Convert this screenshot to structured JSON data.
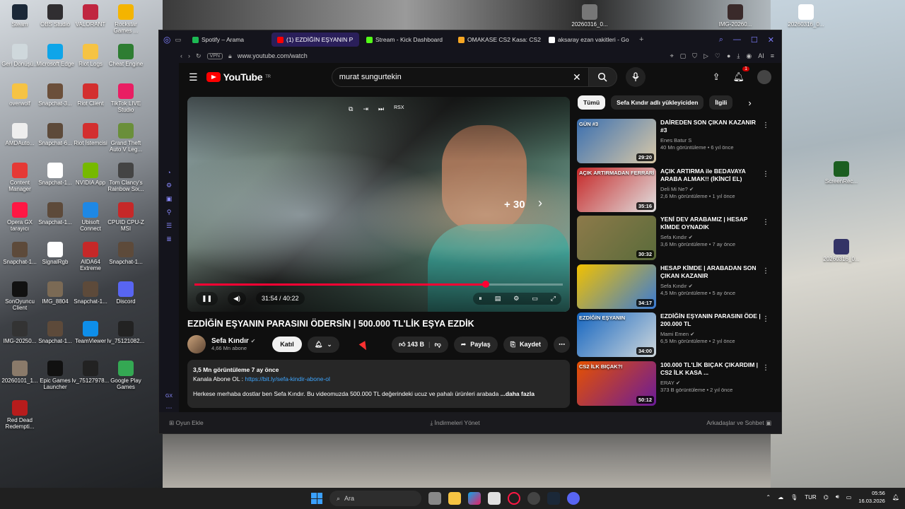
{
  "desktop": {
    "icons": [
      {
        "label": "Steam",
        "color": "#1b2838"
      },
      {
        "label": "OBS Studio",
        "color": "#302e31"
      },
      {
        "label": "VALORANT",
        "color": "#c02640"
      },
      {
        "label": "Rockstar Games ...",
        "color": "#f4b400"
      },
      {
        "label": "Geri Dönüşü...",
        "color": "#cfd8dc"
      },
      {
        "label": "Microsoft Edge",
        "color": "#0ea5e9"
      },
      {
        "label": "Riot Logs",
        "color": "#f6c343"
      },
      {
        "label": "Cheat Engine",
        "color": "#2e7d32"
      },
      {
        "label": "overwolf",
        "color": "#f6c343"
      },
      {
        "label": "Snapchat-3...",
        "color": "#6b4f3a"
      },
      {
        "label": "Riot Client",
        "color": "#d32f2f"
      },
      {
        "label": "TikTok LIVE Studio",
        "color": "#e91e63"
      },
      {
        "label": "AMDAuto...",
        "color": "#eeeeee"
      },
      {
        "label": "Snapchat-6...",
        "color": "#5d4a3a"
      },
      {
        "label": "Riot İstemcisi",
        "color": "#d32f2f"
      },
      {
        "label": "Grand Theft Auto V Leg...",
        "color": "#6a8f3a"
      },
      {
        "label": "Content Manager",
        "color": "#e53935"
      },
      {
        "label": "Snapchat-1...",
        "color": "#ffffff"
      },
      {
        "label": "NVIDIA App",
        "color": "#76b900"
      },
      {
        "label": "Tom Clancy's Rainbow Six...",
        "color": "#444444"
      },
      {
        "label": "Opera GX tarayıcı",
        "color": "#ff1744"
      },
      {
        "label": "Snapchat-1...",
        "color": "#5d4a3a"
      },
      {
        "label": "Ubisoft Connect",
        "color": "#1e88e5"
      },
      {
        "label": "CPUID CPU-Z MSI",
        "color": "#c62828"
      },
      {
        "label": "Snapchat-1...",
        "color": "#5d4a3a"
      },
      {
        "label": "SignalRgb",
        "color": "#ffffff"
      },
      {
        "label": "AIDA64 Extreme",
        "color": "#c62828"
      },
      {
        "label": "Snapchat-1...",
        "color": "#5d4a3a"
      },
      {
        "label": "SonOyuncu Client",
        "color": "#111111"
      },
      {
        "label": "IMG_8804",
        "color": "#7b6a55"
      },
      {
        "label": "Snapchat-1...",
        "color": "#5d4a3a"
      },
      {
        "label": "Discord",
        "color": "#5865f2"
      },
      {
        "label": "IMG-20250...",
        "color": "#333333"
      },
      {
        "label": "Snapchat-1...",
        "color": "#5d4a3a"
      },
      {
        "label": "TeamViewer",
        "color": "#0e8ee9"
      },
      {
        "label": "lv_75121082...",
        "color": "#222222"
      },
      {
        "label": "20260101_1...",
        "color": "#8a7a6a"
      },
      {
        "label": "Epic Games Launcher",
        "color": "#111111"
      },
      {
        "label": "lv_75127978...",
        "color": "#222222"
      },
      {
        "label": "Google Play Games",
        "color": "#34a853"
      },
      {
        "label": "Red Dead Redempti...",
        "color": "#b71c1c"
      }
    ],
    "top_icons": [
      {
        "label": "20260316_0...",
        "color": "#777777"
      },
      {
        "label": "IMG-20260...",
        "color": "#3a2a2a"
      },
      {
        "label": "20260316_0...",
        "color": "#ffffff"
      }
    ],
    "right_icons": [
      {
        "label": "ScreenRec...",
        "color": "#1b5e20"
      },
      {
        "label": "20260316_0...",
        "color": "#333366"
      }
    ]
  },
  "browser": {
    "tabs": [
      {
        "label": "Spotify – Arama",
        "color": "#1db954",
        "active": false
      },
      {
        "label": "(1) EZDİĞİN EŞYANIN P",
        "color": "#ff0000",
        "active": true
      },
      {
        "label": "Stream - Kick Dashboard",
        "color": "#53fc18",
        "active": false
      },
      {
        "label": "OMAKASE CS2 Kasa: CS2",
        "color": "#f6a623",
        "active": false
      },
      {
        "label": "aksaray ezan vakitleri - Go",
        "color": "#ffffff",
        "active": false
      }
    ],
    "new_tab": "+",
    "vpn": "VPN",
    "url": "www.youtube.com/watch",
    "ai": "AI",
    "status_left": "Oyun Ekle",
    "status_mid": "İndirmeleri Yönet",
    "status_right": "Arkadaşlar ve Sohbet",
    "sidebar_label": "GX"
  },
  "youtube": {
    "logo": "YouTube",
    "logo_region": "TR",
    "search_value": "murat sungurtekin",
    "notif_count": "1",
    "player": {
      "time": "31:54 / 40:22",
      "skip": "+ 30",
      "rsx": "RSX",
      "progress_fraction": 0.79
    },
    "video_title": "EZDİĞİN EŞYANIN PARASINI ÖDERSİN | 500.000 TL'LİK EŞYA EZDİK",
    "channel": {
      "name": "Sefa Kındır",
      "subs": "4,66 Mn abone",
      "join": "Katıl"
    },
    "likes": "143 B",
    "share": "Paylaş",
    "save": "Kaydet",
    "description": {
      "stats": "3,5 Mn görüntüleme  7 ay önce",
      "line1_prefix": "Kanala Abone OL : ",
      "line1_link": "https://bit.ly/sefa-kindir-abone-ol",
      "line2": "Herkese merhaba dostlar ben Sefa Kındır.  Bu videomuzda 500.000 TL değerindeki ucuz ve pahalı ürünleri arabada ",
      "more": "...daha fazla"
    },
    "chips": [
      "Tümü",
      "Sefa Kındır adlı yükleyiciden",
      "İlgili"
    ],
    "recommendations": [
      {
        "title": "DAİREDEN SON ÇIKAN KAZANIR #3",
        "channel": "Enes Batur S",
        "meta": "40 Mn görüntüleme • 6 yıl önce",
        "duration": "29:20",
        "thumb_label": "GÜN #3",
        "c1": "#3a6fb0",
        "c2": "#d9c9a8",
        "verified": false
      },
      {
        "title": "AÇIK ARTIRMA ile BEDAVAYA ARABA ALMAK!! (İKİNCİ EL)",
        "channel": "Deli Mi Ne?",
        "meta": "2,6 Mn görüntüleme • 1 yıl önce",
        "duration": "35:16",
        "thumb_label": "AÇIK ARTIRMADAN FERRARİ",
        "c1": "#c62828",
        "c2": "#e0e0e0",
        "verified": true
      },
      {
        "title": "YENİ DEV ARABAMIZ | HESAP KİMDE OYNADIK",
        "channel": "Sefa Kındır",
        "meta": "3,6 Mn görüntüleme • 7 ay önce",
        "duration": "30:32",
        "thumb_label": "",
        "c1": "#8d7a4a",
        "c2": "#5a6b3a",
        "verified": true
      },
      {
        "title": "HESAP KİMDE | ARABADAN SON ÇIKAN KAZANIR",
        "channel": "Sefa Kındır",
        "meta": "4,5 Mn görüntüleme • 5 ay önce",
        "duration": "34:17",
        "thumb_label": "",
        "c1": "#f2c100",
        "c2": "#3a7bd5",
        "verified": true
      },
      {
        "title": "EZDİĞİN EŞYANIN PARASINI ÖDE | 200.000 TL",
        "channel": "Mami Emen",
        "meta": "6,5 Mn görüntüleme • 2 yıl önce",
        "duration": "34:00",
        "thumb_label": "EZDİĞİN EŞYANIN",
        "c1": "#1565c0",
        "c2": "#cfd8dc",
        "verified": true
      },
      {
        "title": "100.000 TL'LİK BIÇAK ÇIKARDIM | CS2 İLK KASA ...",
        "channel": "ERAY",
        "meta": "373 B görüntüleme • 2 yıl önce",
        "duration": "50:12",
        "thumb_label": "CS2 İLK BIÇAK?!",
        "c1": "#e65100",
        "c2": "#6a1b9a",
        "verified": true
      }
    ]
  },
  "taskbar": {
    "search": "Ara",
    "lang": "TUR",
    "time": "05:56",
    "date": "16.03.2026"
  }
}
